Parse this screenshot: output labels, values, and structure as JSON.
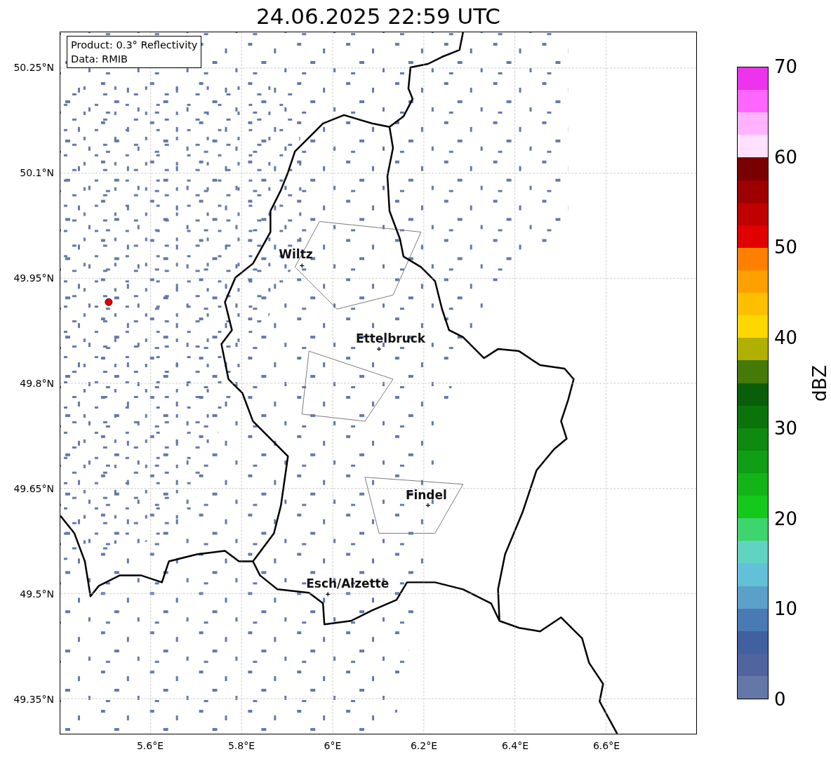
{
  "title": "24.06.2025 22:59 UTC",
  "info_box": [
    "Product: 0.3° Reflectivity",
    "Data: RMIB"
  ],
  "map": {
    "cities": [
      {
        "name": "Wiltz"
      },
      {
        "name": "Ettelbruck"
      },
      {
        "name": "Findel"
      },
      {
        "name": "Esch/Alzette"
      }
    ]
  },
  "axes": {
    "yticks": [
      "50.25°N",
      "50.1°N",
      "49.95°N",
      "49.8°N",
      "49.65°N",
      "49.5°N",
      "49.35°N"
    ],
    "xticks": [
      "5.6°E",
      "5.8°E",
      "6°E",
      "6.2°E",
      "6.4°E",
      "6.6°E"
    ]
  },
  "colorbar": {
    "label": "dBZ",
    "ticks": [
      "70",
      "60",
      "50",
      "40",
      "30",
      "20",
      "10",
      "0"
    ],
    "bins": [
      {
        "color": "#ee33ee"
      },
      {
        "color": "#ff66ff"
      },
      {
        "color": "#ffb3ff"
      },
      {
        "color": "#ffe0ff"
      },
      {
        "color": "#7a0000"
      },
      {
        "color": "#9e0000"
      },
      {
        "color": "#c00000"
      },
      {
        "color": "#e00000"
      },
      {
        "color": "#ff7f00"
      },
      {
        "color": "#ff9f00"
      },
      {
        "color": "#ffbf00"
      },
      {
        "color": "#ffd700"
      },
      {
        "color": "#b0b000"
      },
      {
        "color": "#437a08"
      },
      {
        "color": "#0a5e0a"
      },
      {
        "color": "#0a730a"
      },
      {
        "color": "#0e8a10"
      },
      {
        "color": "#109e14"
      },
      {
        "color": "#12b418"
      },
      {
        "color": "#14c81c"
      },
      {
        "color": "#3ed46e"
      },
      {
        "color": "#60d4c0"
      },
      {
        "color": "#62c0d8"
      },
      {
        "color": "#5aa0c8"
      },
      {
        "color": "#4a7ab4"
      },
      {
        "color": "#4060a0"
      },
      {
        "color": "#5064a0"
      },
      {
        "color": "#6478a8"
      }
    ]
  }
}
